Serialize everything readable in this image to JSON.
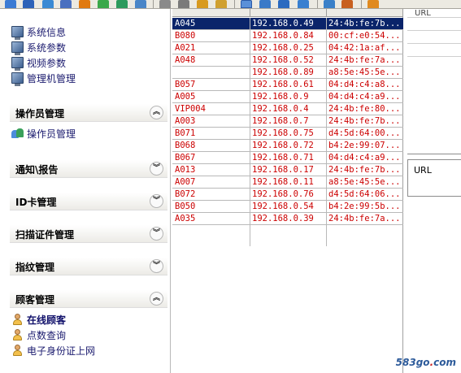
{
  "toolbar": {
    "icons": [
      "window-icon",
      "mail-icon",
      "refresh-icon",
      "network-icon",
      "phone-icon",
      "chat-icon",
      "lock-icon",
      "printer-icon",
      "camera-icon",
      "upload-icon",
      "download-icon",
      "view-icon",
      "grid-icon",
      "map-icon",
      "export-icon",
      "settings-icon",
      "close-icon"
    ]
  },
  "sidebar": {
    "system_items": [
      {
        "label": "系统信息"
      },
      {
        "label": "系统参数"
      },
      {
        "label": "视频参数"
      },
      {
        "label": "管理机管理"
      }
    ],
    "sections": [
      {
        "title": "操作员管理",
        "state": "expanded",
        "items": [
          {
            "label": "操作员管理"
          }
        ]
      },
      {
        "title": "通知\\报告",
        "state": "collapsed"
      },
      {
        "title": "ID卡管理",
        "state": "collapsed"
      },
      {
        "title": "扫描证件管理",
        "state": "collapsed"
      },
      {
        "title": "指纹管理",
        "state": "collapsed"
      },
      {
        "title": "顾客管理",
        "state": "expanded",
        "items": [
          {
            "label": "在线顾客"
          },
          {
            "label": "点数查询"
          },
          {
            "label": "电子身份证上网"
          }
        ]
      }
    ]
  },
  "table": {
    "rows": [
      {
        "name": "A045",
        "ip": "192.168.0.49",
        "mac": "24:4b:fe:7b...",
        "selected": true
      },
      {
        "name": "B080",
        "ip": "192.168.0.84",
        "mac": "00:cf:e0:54..."
      },
      {
        "name": "A021",
        "ip": "192.168.0.25",
        "mac": "04:42:1a:af..."
      },
      {
        "name": "A048",
        "ip": "192.168.0.52",
        "mac": "24:4b:fe:7a..."
      },
      {
        "name": "",
        "ip": "192.168.0.89",
        "mac": "a8:5e:45:5e..."
      },
      {
        "name": "B057",
        "ip": "192.168.0.61",
        "mac": "04:d4:c4:a8..."
      },
      {
        "name": "A005",
        "ip": "192.168.0.9",
        "mac": "04:d4:c4:a9..."
      },
      {
        "name": "VIP004",
        "ip": "192.168.0.4",
        "mac": "24:4b:fe:80..."
      },
      {
        "name": "A003",
        "ip": "192.168.0.7",
        "mac": "24:4b:fe:7b..."
      },
      {
        "name": "B071",
        "ip": "192.168.0.75",
        "mac": "d4:5d:64:00..."
      },
      {
        "name": "B068",
        "ip": "192.168.0.72",
        "mac": "b4:2e:99:07..."
      },
      {
        "name": "B067",
        "ip": "192.168.0.71",
        "mac": "04:d4:c4:a9..."
      },
      {
        "name": "A013",
        "ip": "192.168.0.17",
        "mac": "24:4b:fe:7b..."
      },
      {
        "name": "A007",
        "ip": "192.168.0.11",
        "mac": "a8:5e:45:5e..."
      },
      {
        "name": "B072",
        "ip": "192.168.0.76",
        "mac": "d4:5d:64:06..."
      },
      {
        "name": "B050",
        "ip": "192.168.0.54",
        "mac": "b4:2e:99:5b..."
      },
      {
        "name": "A035",
        "ip": "192.168.0.39",
        "mac": "24:4b:fe:7a..."
      }
    ]
  },
  "right_panel": {
    "url_top": "URL",
    "url_label": "URL"
  },
  "watermark": {
    "text_a": "583go",
    "text_dot": ".",
    "text_b": "com"
  },
  "colors": {
    "row_text": "#cc0000",
    "selected_bg": "#0a246a",
    "selected_text": "#ffffff"
  }
}
